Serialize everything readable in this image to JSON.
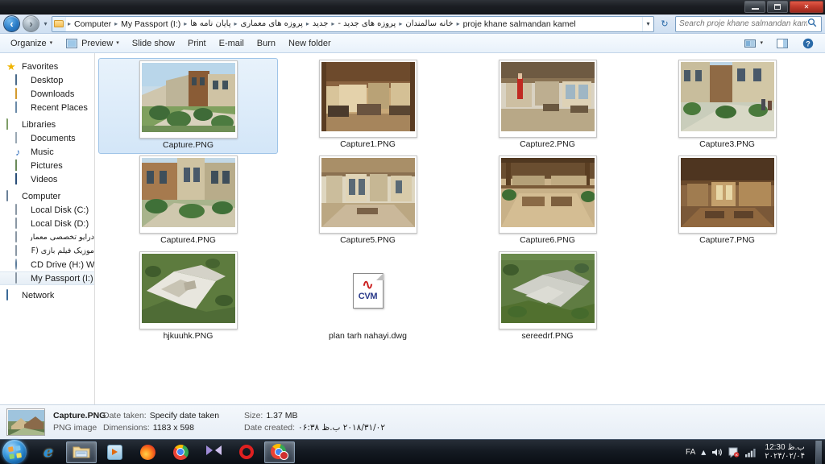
{
  "window": {
    "controls": {
      "minimize": "minimize-button",
      "maximize": "maximize-button",
      "close": "✕"
    }
  },
  "address_bar": {
    "back_glyph": "‹",
    "forward_glyph": "›",
    "history_glyph": "▾",
    "folder_icon": "folder-icon",
    "crumbs": [
      {
        "label": "Computer",
        "rtl": false
      },
      {
        "label": "My Passport (I:)",
        "rtl": false
      },
      {
        "label": "پایان نامه ها",
        "rtl": true
      },
      {
        "label": "پروزه های معماری",
        "rtl": true
      },
      {
        "label": "جدید",
        "rtl": true
      },
      {
        "label": "پروزه های جدید -",
        "rtl": true
      },
      {
        "label": "خانه سالمندان",
        "rtl": true
      },
      {
        "label": "proje khane salmandan kamel",
        "rtl": false
      }
    ],
    "separator": "▸",
    "dropdown_glyph": "▾",
    "refresh_glyph": "↻"
  },
  "search": {
    "placeholder": "Search proje khane salmandan kamel",
    "value": "",
    "icon": "search-icon"
  },
  "toolbar": {
    "organize": "Organize",
    "preview": "Preview",
    "slide_show": "Slide show",
    "print": "Print",
    "email": "E-mail",
    "burn": "Burn",
    "new_folder": "New folder",
    "caret": "▾",
    "help_glyph": "?"
  },
  "sidebar": {
    "groups": [
      {
        "header": {
          "label": "Favorites",
          "icon": "star-icon"
        },
        "items": [
          {
            "label": "Desktop",
            "icon": "desktop-icon",
            "rtl": false
          },
          {
            "label": "Downloads",
            "icon": "downloads-folder-icon",
            "rtl": false
          },
          {
            "label": "Recent Places",
            "icon": "recent-places-icon",
            "rtl": false
          }
        ]
      },
      {
        "header": {
          "label": "Libraries",
          "icon": "libraries-folder-icon"
        },
        "items": [
          {
            "label": "Documents",
            "icon": "documents-icon",
            "rtl": false
          },
          {
            "label": "Music",
            "icon": "music-icon",
            "rtl": false
          },
          {
            "label": "Pictures",
            "icon": "pictures-icon",
            "rtl": false
          },
          {
            "label": "Videos",
            "icon": "videos-icon",
            "rtl": false
          }
        ]
      },
      {
        "header": {
          "label": "Computer",
          "icon": "computer-icon"
        },
        "items": [
          {
            "label": "Local Disk (C:)",
            "icon": "system-drive-icon",
            "rtl": false
          },
          {
            "label": "Local Disk (D:)",
            "icon": "drive-icon",
            "rtl": false
          },
          {
            "label": "درایو تخصصی معماری",
            "icon": "drive-icon",
            "rtl": true
          },
          {
            "label": "موزیک فیلم بازی (F:)",
            "icon": "drive-icon",
            "rtl": true
          },
          {
            "label": "CD Drive (H:) WD Un",
            "icon": "cd-drive-icon",
            "rtl": false
          },
          {
            "label": "My Passport (I:)",
            "icon": "drive-icon",
            "rtl": false,
            "selected": true
          }
        ]
      },
      {
        "header": {
          "label": "Network",
          "icon": "network-icon"
        },
        "items": []
      }
    ]
  },
  "files": [
    {
      "name": "Capture.PNG",
      "type": "image",
      "selected": true,
      "thumb_w": 116,
      "thumb_h": 86
    },
    {
      "name": "Capture1.PNG",
      "type": "image",
      "selected": false,
      "thumb_w": 116,
      "thumb_h": 86
    },
    {
      "name": "Capture2.PNG",
      "type": "image",
      "selected": false,
      "thumb_w": 116,
      "thumb_h": 86
    },
    {
      "name": "Capture3.PNG",
      "type": "image",
      "selected": false,
      "thumb_w": 116,
      "thumb_h": 86
    },
    {
      "name": "Capture4.PNG",
      "type": "image",
      "selected": false,
      "thumb_w": 116,
      "thumb_h": 86
    },
    {
      "name": "Capture5.PNG",
      "type": "image",
      "selected": false,
      "thumb_w": 116,
      "thumb_h": 86
    },
    {
      "name": "Capture6.PNG",
      "type": "image",
      "selected": false,
      "thumb_w": 116,
      "thumb_h": 86
    },
    {
      "name": "Capture7.PNG",
      "type": "image",
      "selected": false,
      "thumb_w": 116,
      "thumb_h": 86
    },
    {
      "name": "hjkuuhk.PNG",
      "type": "image",
      "selected": false,
      "thumb_w": 116,
      "thumb_h": 86
    },
    {
      "name": "plan tarh nahayi.dwg",
      "type": "dwg",
      "selected": false,
      "icon_text_top": "squiggle",
      "icon_text": "CVM"
    },
    {
      "name": "sereedrf.PNG",
      "type": "image",
      "selected": false,
      "thumb_w": 116,
      "thumb_h": 86
    }
  ],
  "details": {
    "file_name": "Capture.PNG",
    "file_type": "PNG image",
    "date_taken_label": "Date taken:",
    "date_taken_value": "Specify date taken",
    "dimensions_label": "Dimensions:",
    "dimensions_value": "1183 x 598",
    "size_label": "Size:",
    "size_value": "1.37 MB",
    "date_created_label": "Date created:",
    "date_created_value": "۲۰۱۸/۳۱/۰۲ ب.ظ ۰۶:۳۸"
  },
  "taskbar": {
    "start": "start-orb",
    "buttons": [
      {
        "name": "internet-explorer",
        "active": false
      },
      {
        "name": "windows-explorer",
        "active": true
      },
      {
        "name": "windows-media-player",
        "active": false
      },
      {
        "name": "firefox",
        "active": false
      },
      {
        "name": "google-chrome",
        "active": false
      },
      {
        "name": "windows-movie-maker",
        "active": false
      },
      {
        "name": "opera",
        "active": false
      },
      {
        "name": "google-chrome-window",
        "active": true
      }
    ],
    "tray": {
      "language": "FA",
      "show_hidden_glyph": "▴",
      "volume": "volume-icon",
      "action_center": "action-center-icon",
      "network": "network-signal-icon",
      "clock_time": "ب.ظ 12:30",
      "clock_date": "۲۰۲۴/۰۲/۰۴"
    }
  },
  "colors": {
    "accent": "#2a7cc7",
    "selection": "#d3e6f8",
    "close_button": "#c0392b"
  }
}
